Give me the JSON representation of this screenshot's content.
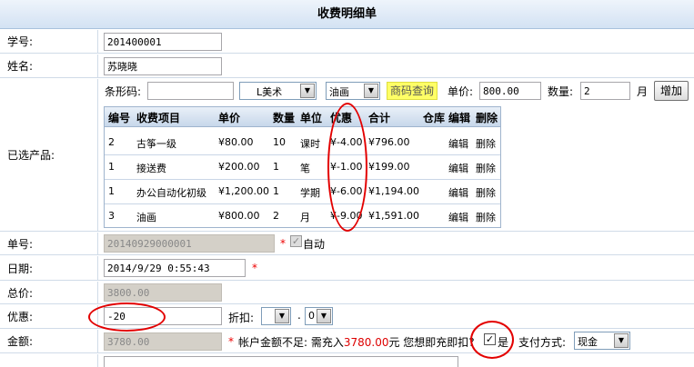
{
  "title": "收费明细单",
  "student_id": {
    "label": "学号:",
    "value": "201400001"
  },
  "name": {
    "label": "姓名:",
    "value": "苏晓晓"
  },
  "products": {
    "label": "已选产品:",
    "barcode_label": "条形码:",
    "barcode_value": "",
    "category1": "L美术",
    "category2": "油画",
    "query_button": "商码查询",
    "price_label": "单价:",
    "price_value": "800.00",
    "qty_label": "数量:",
    "qty_value": "2",
    "unit": "月",
    "add_button": "增加",
    "table": {
      "headers": [
        "编号",
        "收费项目",
        "单价",
        "数量",
        "单位",
        "优惠",
        "合计",
        "仓库",
        "编辑",
        "删除"
      ],
      "rows": [
        {
          "id": "2",
          "item": "古筝一级",
          "price": "¥80.00",
          "qty": "10",
          "unit": "课时",
          "discount": "¥-4.00",
          "total": "¥796.00",
          "edit": "编辑",
          "del": "删除"
        },
        {
          "id": "1",
          "item": "接送费",
          "price": "¥200.00",
          "qty": "1",
          "unit": "笔",
          "discount": "¥-1.00",
          "total": "¥199.00",
          "edit": "编辑",
          "del": "删除"
        },
        {
          "id": "1",
          "item": "办公自动化初级",
          "price": "¥1,200.00",
          "qty": "1",
          "unit": "学期",
          "discount": "¥-6.00",
          "total": "¥1,194.00",
          "edit": "编辑",
          "del": "删除"
        },
        {
          "id": "3",
          "item": "油画",
          "price": "¥800.00",
          "qty": "2",
          "unit": "月",
          "discount": "¥-9.00",
          "total": "¥1,591.00",
          "edit": "编辑",
          "del": "删除"
        }
      ]
    }
  },
  "order_no": {
    "label": "单号:",
    "value": "20140929000001",
    "auto_label": "自动"
  },
  "date": {
    "label": "日期:",
    "value": "2014/9/29 0:55:43"
  },
  "total": {
    "label": "总价:",
    "value": "3800.00"
  },
  "discount": {
    "label": "优惠:",
    "value": "-20",
    "rate_label": "折扣:",
    "rate_int": "",
    "rate_sep": ".",
    "rate_dec": "0"
  },
  "amount": {
    "label": "金额:",
    "value": "3780.00",
    "msg_prefix": "帐户金额不足: 需充入",
    "msg_amount": "3780.00",
    "msg_suffix": "元 您想即充即扣?",
    "yes_label": "是",
    "pay_label": "支付方式:",
    "pay_value": "现金"
  },
  "colors": {
    "accent_red": "#e30000",
    "header_bg": "#d3e2f3",
    "query_bg": "#ffff66"
  }
}
